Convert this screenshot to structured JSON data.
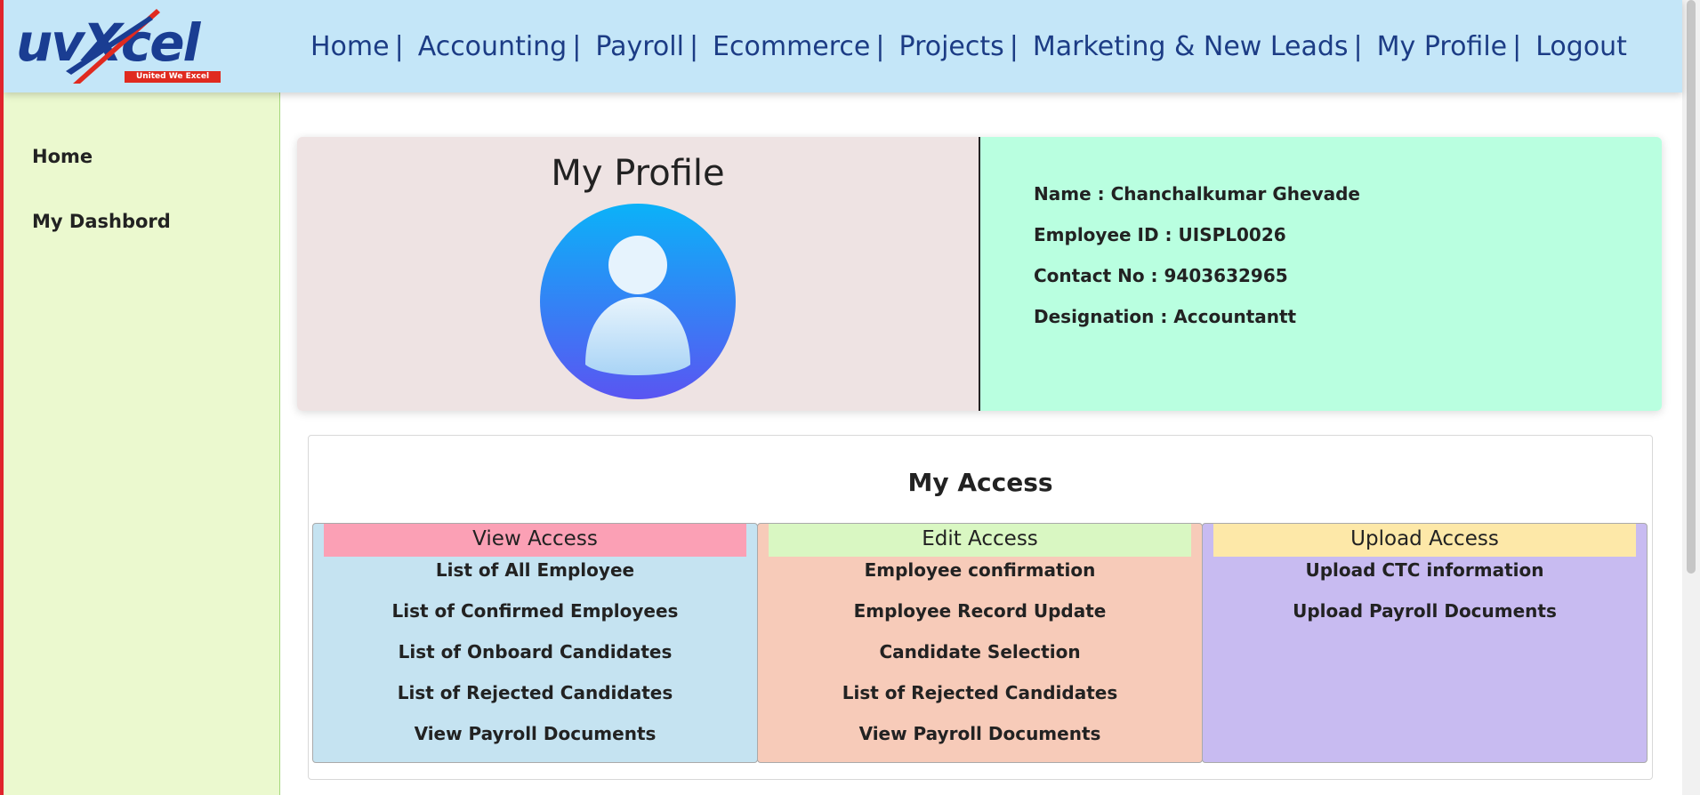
{
  "brand": {
    "logo_text": "uvxcel",
    "tagline": "United We Excel",
    "colors": {
      "blue": "#1a3d92",
      "red": "#e02a1f"
    }
  },
  "nav": {
    "items": [
      "Home",
      "Accounting",
      "Payroll",
      "Ecommerce",
      "Projects",
      "Marketing & New Leads",
      "My Profile",
      "Logout"
    ],
    "separator": "|"
  },
  "sidebar": {
    "items": [
      "Home",
      "My Dashbord"
    ]
  },
  "profile": {
    "title": "My Profile",
    "name": "Name : Chanchalkumar Ghevade",
    "employee_id": "Employee ID : UISPL0026",
    "contact": "Contact No : 9403632965",
    "designation": "Designation : Accountantt"
  },
  "access": {
    "title": "My Access",
    "view": {
      "heading": "View Access",
      "color": "#fba0b5",
      "items": [
        "List of All Employee",
        "List of Confirmed Employees",
        "List of Onboard Candidates",
        "List of Rejected Candidates",
        "View Payroll Documents"
      ]
    },
    "edit": {
      "heading": "Edit Access",
      "color": "#d9f7c2",
      "items": [
        "Employee confirmation",
        "Employee Record Update",
        "Candidate Selection",
        "List of Rejected Candidates",
        "View Payroll Documents"
      ]
    },
    "upload": {
      "heading": "Upload Access",
      "color": "#fde8a8",
      "items": [
        "Upload CTC information",
        "Upload Payroll Documents"
      ]
    }
  }
}
